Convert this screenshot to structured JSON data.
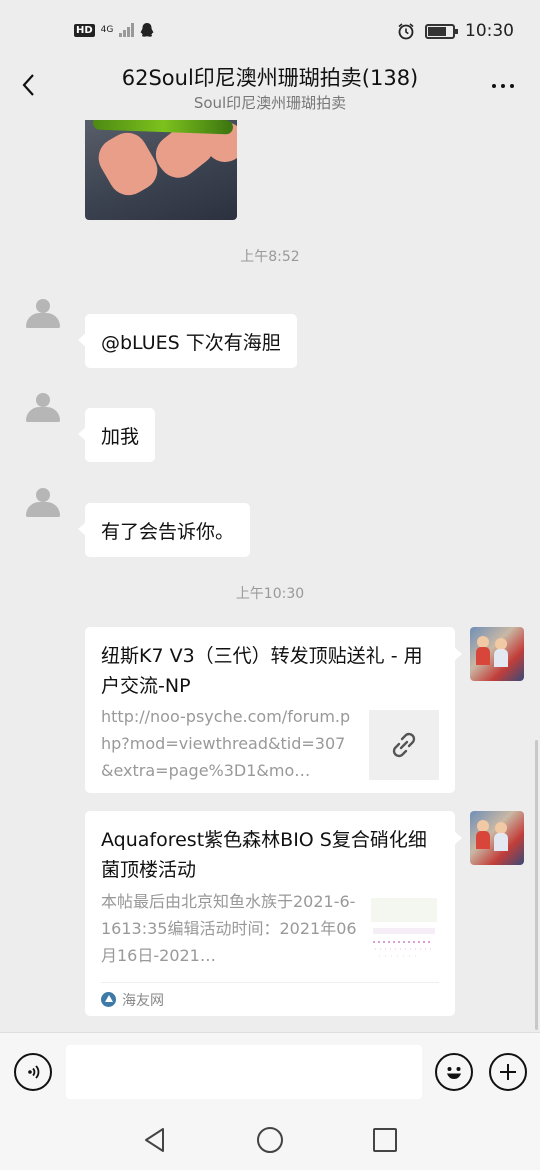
{
  "status_bar": {
    "network": "4G",
    "time": "10:30",
    "battery_level": 0.7
  },
  "header": {
    "title": "62Soul印尼澳州珊瑚拍卖(138)",
    "subtitle": "Soul印尼澳州珊瑚拍卖"
  },
  "timestamps": {
    "first": "上午8:52",
    "second": "上午10:30"
  },
  "messages": [
    {
      "text": "@bLUES  下次有海胆"
    },
    {
      "text": "加我"
    },
    {
      "text": "有了会告诉你。"
    }
  ],
  "cards": [
    {
      "title": "纽斯K7 V3（三代）转发顶贴送礼 - 用户交流-NP",
      "description": "http://noo-psyche.com/forum.php?mod=viewthread&tid=307&extra=page%3D1&mo…"
    },
    {
      "title": "Aquaforest紫色森林BIO S复合硝化细菌顶楼活动",
      "description": "本帖最后由北京知鱼水族于2021-6-1613:35编辑活动时间：2021年06月16日-2021…",
      "source": "海友网"
    }
  ],
  "icons": {
    "back": "chevron-left-icon",
    "more": "more-dots-icon",
    "voice": "voice-icon",
    "emoji": "emoji-icon",
    "plus": "plus-icon",
    "link": "link-icon"
  }
}
